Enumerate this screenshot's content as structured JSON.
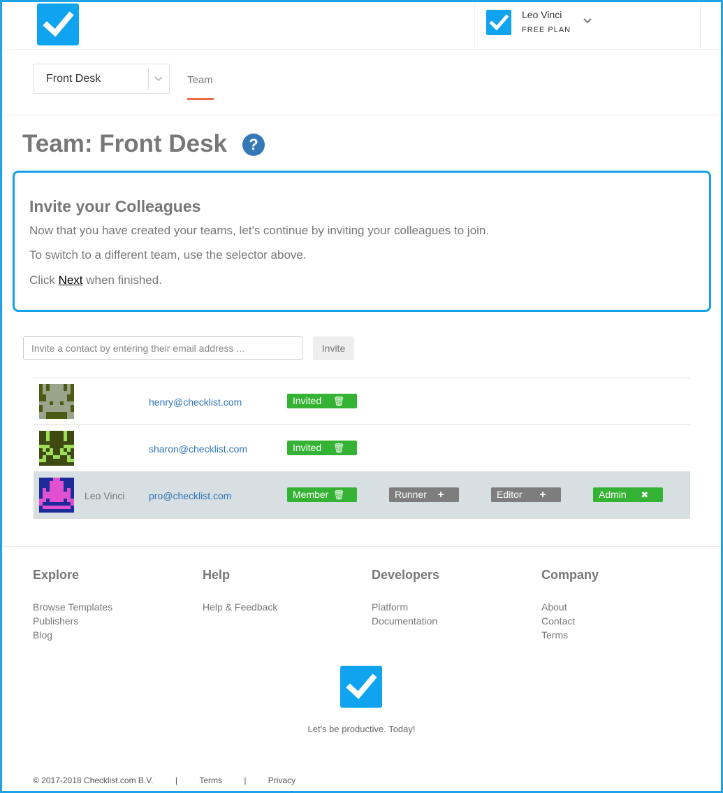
{
  "header": {
    "user_name": "Leo Vinci",
    "user_plan": "FREE PLAN",
    "brand_color": "#0fa3f0"
  },
  "subnav": {
    "team_selected": "Front Desk",
    "tab_team": "Team"
  },
  "page": {
    "title": "Team: Front Desk",
    "help_icon_glyph": "?"
  },
  "invite_box": {
    "title": "Invite your Colleagues",
    "line1": "Now that you have created your teams, let's continue by inviting your colleagues to join.",
    "line2": "To switch to a different team, use the selector above.",
    "line3_prefix": "Click ",
    "line3_link": "Next",
    "line3_suffix": " when finished."
  },
  "invite_form": {
    "placeholder": "Invite a contact by entering their email address ...",
    "button_label": "Invite"
  },
  "members": [
    {
      "name": "",
      "email": "henry@checklist.com",
      "status": "Invited",
      "avatar_fg": "#9aa48b",
      "avatar_bg": "#4b5a14"
    },
    {
      "name": "",
      "email": "sharon@checklist.com",
      "status": "Invited",
      "avatar_fg": "#9ce05a",
      "avatar_bg": "#3f4a12"
    },
    {
      "name": "Leo Vinci",
      "email": "pro@checklist.com",
      "status": "Member",
      "avatar_fg": "#e050d0",
      "avatar_bg": "#1c2a9a",
      "roles": {
        "runner": "Runner",
        "editor": "Editor",
        "admin": "Admin"
      }
    }
  ],
  "footer": {
    "explore": {
      "heading": "Explore",
      "links": [
        "Browse Templates",
        "Publishers",
        "Blog"
      ]
    },
    "help": {
      "heading": "Help",
      "links": [
        "Help & Feedback"
      ]
    },
    "developers": {
      "heading": "Developers",
      "links": [
        "Platform",
        "Documentation"
      ]
    },
    "company": {
      "heading": "Company",
      "links": [
        "About",
        "Contact",
        "Terms"
      ]
    },
    "tagline": "Let's be productive. Today!",
    "copyright": "© 2017-2018 Checklist.com B.V.",
    "separator": "|",
    "terms": "Terms",
    "privacy": "Privacy"
  }
}
